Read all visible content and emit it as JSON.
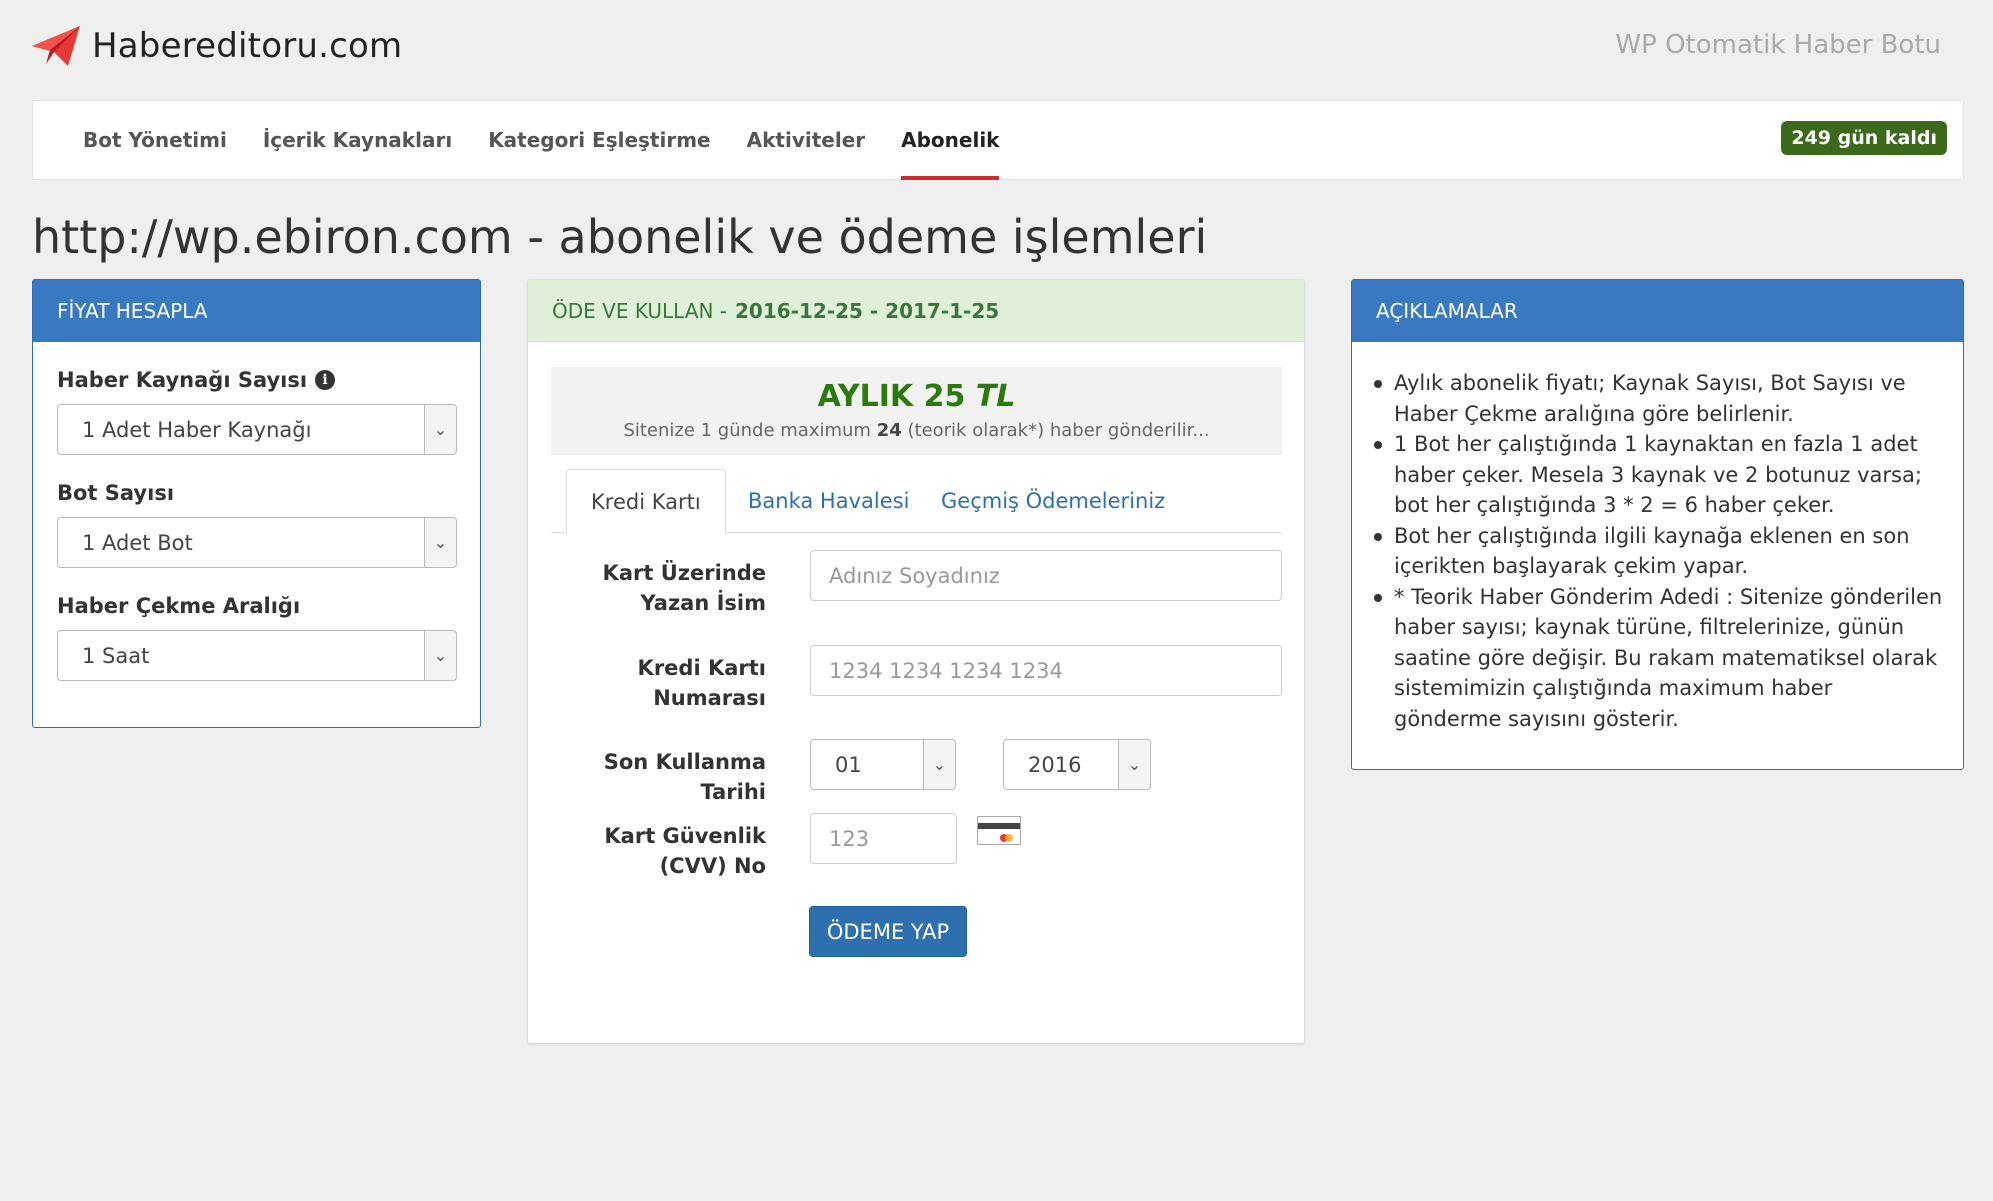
{
  "header": {
    "brand": "Habereditoru.com",
    "tagline": "WP Otomatik Haber Botu",
    "logo_icon": "paper-plane-icon",
    "accent_color": "#e53935"
  },
  "nav": {
    "items": [
      {
        "label": "Bot Yönetimi"
      },
      {
        "label": "İçerik Kaynakları"
      },
      {
        "label": "Kategori Eşleştirme"
      },
      {
        "label": "Aktiviteler"
      },
      {
        "label": "Abonelik"
      }
    ],
    "active": "Abonelik",
    "remaining_badge": "249 gün kaldı"
  },
  "page_title": "http://wp.ebiron.com - abonelik ve ödeme işlemleri",
  "price_panel": {
    "title": "FİYAT HESAPLA",
    "fields": [
      {
        "label": "Haber Kaynağı Sayısı",
        "value": "1 Adet Haber Kaynağı"
      },
      {
        "label": "Bot Sayısı",
        "value": "1 Adet Bot"
      },
      {
        "label": "Haber Çekme Aralığı",
        "value": "1 Saat"
      }
    ]
  },
  "payment_panel": {
    "title_prefix": "ÖDE VE KULLAN -",
    "title_dates": "2016-12-25 - 2017-1-25",
    "plan_price_main": "AYLIK 25",
    "plan_currency": "TL",
    "plan_note_prefix": "Sitenize 1 günde maximum",
    "plan_note_count": "24",
    "plan_note_suffix": "(teorik olarak*) haber gönderilir...",
    "tabs": [
      {
        "label": "Kredi Kartı"
      },
      {
        "label": "Banka Havalesi"
      },
      {
        "label": "Geçmiş Ödemeleriniz"
      }
    ],
    "active_tab": "Kredi Kartı",
    "form": {
      "name_label": "Kart Üzerinde Yazan İsim",
      "name_placeholder": "Adınız Soyadınız",
      "card_label": "Kredi Kartı Numarası",
      "card_placeholder": "1234 1234 1234 1234",
      "expiry_label": "Son Kullanma Tarihi",
      "expiry_month": "01",
      "expiry_year": "2016",
      "cvv_label": "Kart Güvenlik (CVV) No",
      "cvv_placeholder": "123",
      "submit_label": "ÖDEME YAP"
    }
  },
  "notes_panel": {
    "title": "AÇIKLAMALAR",
    "items": [
      "Aylık abonelik fiyatı; Kaynak Sayısı, Bot Sayısı ve Haber Çekme aralığına göre belirlenir.",
      "1 Bot her çalıştığında 1 kaynaktan en fazla 1 adet haber çeker. Mesela 3 kaynak ve 2 botunuz varsa; bot her çalıştığında 3 * 2 = 6 haber çeker.",
      "Bot her çalıştığında ilgili kaynağa eklenen en son içerikten başlayarak çekim yapar.",
      "* Teorik Haber Gönderim Adedi : Sitenize gönderilen haber sayısı; kaynak türüne, filtrelerinize, günün saatine göre değişir. Bu rakam matematiksel olarak sistemimizin çalıştığında maximum haber gönderme sayısını gösterir."
    ]
  }
}
